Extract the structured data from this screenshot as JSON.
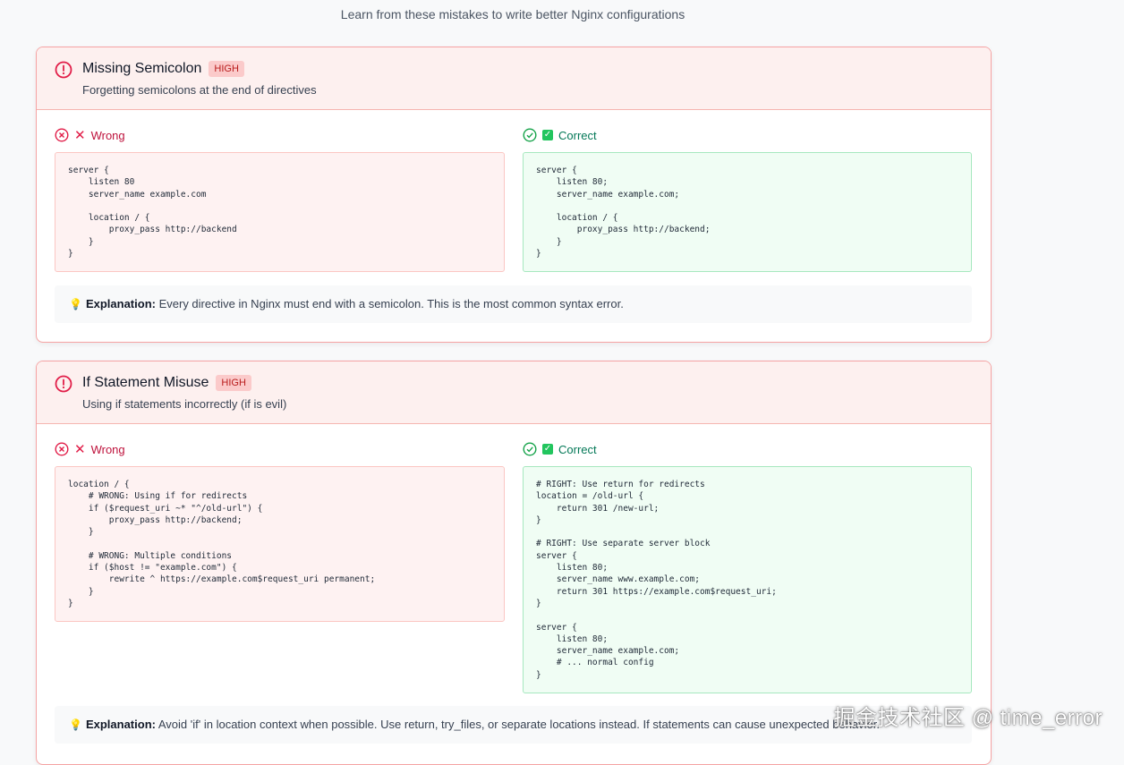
{
  "page": {
    "subtitle": "Learn from these mistakes to write better Nginx configurations"
  },
  "labels": {
    "wrong": "Wrong",
    "correct": "Correct",
    "explanation": "Explanation:"
  },
  "mistakes": [
    {
      "title": "Missing Semicolon",
      "severity": "HIGH",
      "description": "Forgetting semicolons at the end of directives",
      "wrong_code": "server {\n    listen 80\n    server_name example.com\n\n    location / {\n        proxy_pass http://backend\n    }\n}",
      "correct_code": "server {\n    listen 80;\n    server_name example.com;\n\n    location / {\n        proxy_pass http://backend;\n    }\n}",
      "explanation": "Every directive in Nginx must end with a semicolon. This is the most common syntax error."
    },
    {
      "title": "If Statement Misuse",
      "severity": "HIGH",
      "description": "Using if statements incorrectly (if is evil)",
      "wrong_code": "location / {\n    # WRONG: Using if for redirects\n    if ($request_uri ~* \"^/old-url\") {\n        proxy_pass http://backend;\n    }\n\n    # WRONG: Multiple conditions\n    if ($host != \"example.com\") {\n        rewrite ^ https://example.com$request_uri permanent;\n    }\n}",
      "correct_code": "# RIGHT: Use return for redirects\nlocation = /old-url {\n    return 301 /new-url;\n}\n\n# RIGHT: Use separate server block\nserver {\n    listen 80;\n    server_name www.example.com;\n    return 301 https://example.com$request_uri;\n}\n\nserver {\n    listen 80;\n    server_name example.com;\n    # ... normal config\n}",
      "explanation": "Avoid 'if' in location context when possible. Use return, try_files, or separate locations instead. If statements can cause unexpected behavior."
    }
  ],
  "watermark": "掘金技术社区 @ time_error",
  "colors": {
    "danger": "#e11d48",
    "success": "#22c55e",
    "header_bg": "#fdf0ef",
    "card_border": "#f5a3a3"
  },
  "icons": [
    "alert-circle-icon",
    "x-circle-icon",
    "x-mark-icon",
    "check-circle-icon",
    "checkbox-icon",
    "lightbulb-icon"
  ]
}
